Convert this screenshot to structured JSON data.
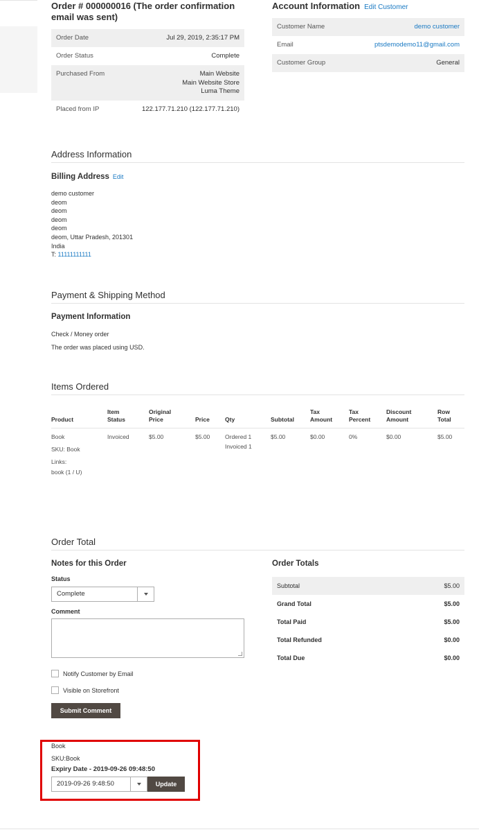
{
  "order": {
    "title": "Order # 000000016 (The order confirmation email was sent)",
    "rows": [
      {
        "label": "Order Date",
        "value": "Jul 29, 2019, 2:35:17 PM"
      },
      {
        "label": "Order Status",
        "value": "Complete"
      },
      {
        "label": "Purchased From",
        "value_lines": [
          "Main Website",
          "Main Website Store",
          "Luma Theme"
        ]
      },
      {
        "label": "Placed from IP",
        "value": "122.177.71.210 (122.177.71.210)"
      }
    ]
  },
  "account": {
    "title": "Account Information",
    "edit_label": "Edit Customer",
    "rows": [
      {
        "label": "Customer Name",
        "value": "demo customer"
      },
      {
        "label": "Email",
        "value": "ptsdemodemo11@gmail.com"
      },
      {
        "label": "Customer Group",
        "value": "General"
      }
    ]
  },
  "address": {
    "section_title": "Address Information",
    "billing_title": "Billing Address",
    "edit_label": "Edit",
    "lines": [
      "demo customer",
      "deom",
      "deom",
      "deom",
      "deom",
      "deom, Uttar Pradesh, 201301",
      "India"
    ],
    "phone_prefix": "T: ",
    "phone": "11111111111"
  },
  "payment": {
    "section_title": "Payment & Shipping Method",
    "info_title": "Payment Information",
    "method": "Check / Money order",
    "currency_note": "The order was placed using USD."
  },
  "items": {
    "section_title": "Items Ordered",
    "headers": [
      {
        "l1": "",
        "l2": "Product"
      },
      {
        "l1": "Item",
        "l2": "Status"
      },
      {
        "l1": "Original",
        "l2": "Price"
      },
      {
        "l1": "",
        "l2": "Price"
      },
      {
        "l1": "",
        "l2": "Qty"
      },
      {
        "l1": "",
        "l2": "Subtotal"
      },
      {
        "l1": "Tax",
        "l2": "Amount"
      },
      {
        "l1": "Tax",
        "l2": "Percent"
      },
      {
        "l1": "Discount",
        "l2": "Amount"
      },
      {
        "l1": "Row",
        "l2": "Total"
      }
    ],
    "row": {
      "product": "Book",
      "sku": "SKU: Book",
      "links_label": "Links:",
      "link_value": "book (1 / U)",
      "status": "Invoiced",
      "original_price": "$5.00",
      "price": "$5.00",
      "qty_ordered": "Ordered 1",
      "qty_invoiced": "Invoiced 1",
      "subtotal": "$5.00",
      "tax_amount": "$0.00",
      "tax_percent": "0%",
      "discount": "$0.00",
      "row_total": "$5.00"
    }
  },
  "order_total": {
    "section_title": "Order Total",
    "notes_title": "Notes for this Order",
    "status_label": "Status",
    "status_value": "Complete",
    "comment_label": "Comment",
    "notify_label": "Notify Customer by Email",
    "visible_label": "Visible on Storefront",
    "submit_label": "Submit Comment",
    "totals_title": "Order Totals",
    "totals": [
      {
        "label": "Subtotal",
        "value": "$5.00"
      },
      {
        "label": "Grand Total",
        "value": "$5.00"
      },
      {
        "label": "Total Paid",
        "value": "$5.00"
      },
      {
        "label": "Total Refunded",
        "value": "$0.00"
      },
      {
        "label": "Total Due",
        "value": "$0.00"
      }
    ]
  },
  "expiry": {
    "product": "Book",
    "sku": "SKU:Book",
    "expiry_text": "Expiry Date - 2019-09-26 09:48:50",
    "select_value": "2019-09-26 9:48:50",
    "update_label": "Update"
  },
  "colors": {
    "link": "#1979c3",
    "button": "#514943",
    "highlight_border": "#e00000",
    "row_shade": "#efefef"
  }
}
